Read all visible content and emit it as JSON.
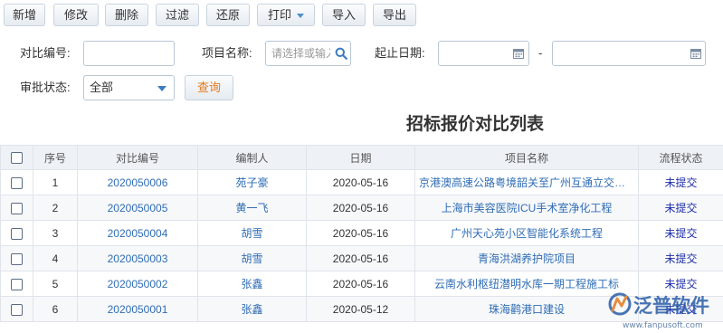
{
  "toolbar": {
    "buttons": [
      "新增",
      "修改",
      "删除",
      "过滤",
      "还原",
      "打印",
      "导入",
      "导出"
    ]
  },
  "filters": {
    "compare_no_label": "对比编号:",
    "project_name_label": "项目名称:",
    "project_name_placeholder": "请选择或输入",
    "date_range_label": "起止日期:",
    "date_separator": "-",
    "approval_status_label": "审批状态:",
    "approval_status_value": "全部",
    "query_label": "查询"
  },
  "page_title": "招标报价对比列表",
  "table": {
    "columns": [
      "序号",
      "对比编号",
      "编制人",
      "日期",
      "项目名称",
      "流程状态"
    ],
    "rows": [
      {
        "no": "1",
        "code": "2020050006",
        "author": "苑子豪",
        "date": "2020-05-16",
        "project": "京港澳高速公路粤境韶关至广州互通立交工程",
        "status": "未提交"
      },
      {
        "no": "2",
        "code": "2020050005",
        "author": "黄一飞",
        "date": "2020-05-16",
        "project": "上海市美容医院ICU手术室净化工程",
        "status": "未提交"
      },
      {
        "no": "3",
        "code": "2020050004",
        "author": "胡雪",
        "date": "2020-05-16",
        "project": "广州天心苑小区智能化系统工程",
        "status": "未提交"
      },
      {
        "no": "4",
        "code": "2020050003",
        "author": "胡雪",
        "date": "2020-05-16",
        "project": "青海洪湖养护院项目",
        "status": "未提交"
      },
      {
        "no": "5",
        "code": "2020050002",
        "author": "张鑫",
        "date": "2020-05-16",
        "project": "云南水利枢纽潜明水库一期工程施工标",
        "status": "未提交"
      },
      {
        "no": "6",
        "code": "2020050001",
        "author": "张鑫",
        "date": "2020-05-12",
        "project": "珠海鹳港口建设",
        "status": "未提交"
      }
    ]
  },
  "watermark": {
    "name": "泛普软件",
    "url": "www.fanpusoft.com"
  },
  "colors": {
    "link": "#2f6db5",
    "status": "#1e2ea8",
    "query_text": "#e07a1a",
    "header_bg": "#eef2f7"
  }
}
